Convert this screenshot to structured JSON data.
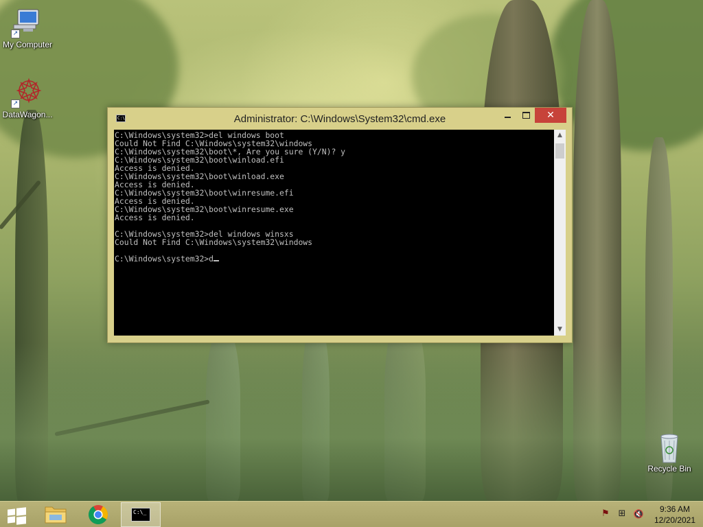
{
  "desktop": {
    "icons": [
      {
        "label": "My Computer",
        "icon": "computer-icon"
      },
      {
        "label": "DataWagon...",
        "icon": "datawagon-icon"
      },
      {
        "label": "Recycle Bin",
        "icon": "recycle-bin-icon"
      }
    ]
  },
  "cmd_window": {
    "title": "Administrator: C:\\Windows\\System32\\cmd.exe",
    "app_icon_text": "C:\\",
    "close_glyph": "✕",
    "lines": [
      "C:\\Windows\\system32>del windows boot",
      "Could Not Find C:\\Windows\\system32\\windows",
      "C:\\Windows\\system32\\boot\\*, Are you sure (Y/N)? y",
      "C:\\Windows\\system32\\boot\\winload.efi",
      "Access is denied.",
      "C:\\Windows\\system32\\boot\\winload.exe",
      "Access is denied.",
      "C:\\Windows\\system32\\boot\\winresume.efi",
      "Access is denied.",
      "C:\\Windows\\system32\\boot\\winresume.exe",
      "Access is denied.",
      "",
      "C:\\Windows\\system32>del windows winsxs",
      "Could Not Find C:\\Windows\\system32\\windows",
      ""
    ],
    "current_prompt": "C:\\Windows\\system32>",
    "current_input": "d",
    "scroll_up_glyph": "▲",
    "scroll_down_glyph": "▼"
  },
  "taskbar": {
    "buttons": [
      {
        "name": "start",
        "icon": "windows-logo-icon"
      },
      {
        "name": "file-explorer",
        "icon": "folder-icon"
      },
      {
        "name": "chrome",
        "icon": "chrome-icon"
      },
      {
        "name": "cmd",
        "icon": "cmd-icon",
        "text": "C:\\_"
      }
    ],
    "tray": {
      "flag_glyph": "⚑",
      "network_glyph": "⊞",
      "volume_glyph": "🔇"
    },
    "clock": {
      "time": "9:36 AM",
      "date": "12/20/2021"
    }
  },
  "colors": {
    "close_button": "#c7433a",
    "window_frame": "#d8d08a",
    "taskbar": "#a9a36a",
    "console_bg": "#000000",
    "console_fg": "#c0c0c0"
  }
}
